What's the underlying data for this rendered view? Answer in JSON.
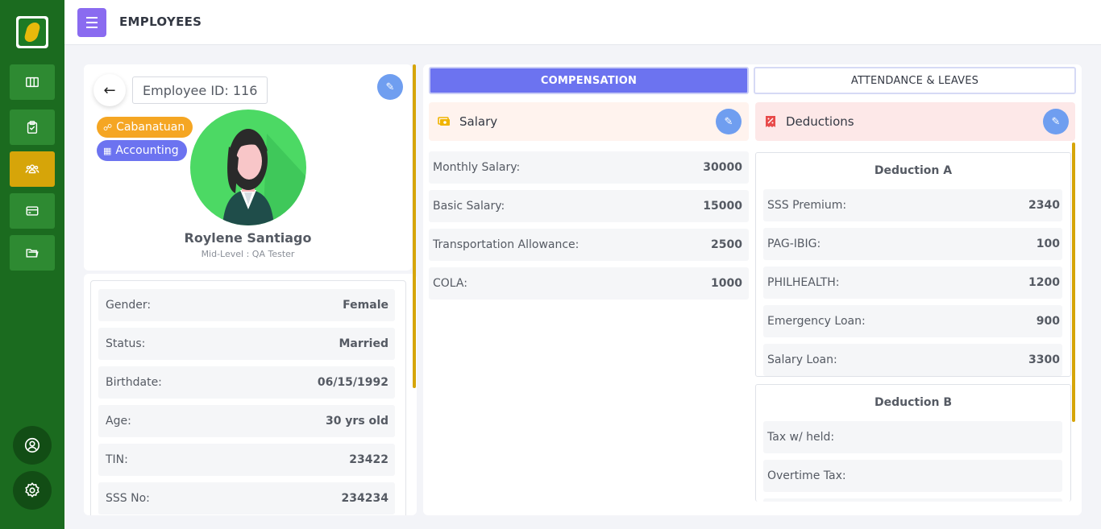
{
  "header": {
    "title": "EMPLOYEES"
  },
  "sidebar": {
    "items": [
      {
        "icon": "dashboard-icon",
        "active": false
      },
      {
        "icon": "clipboard-icon",
        "active": false
      },
      {
        "icon": "employees-icon",
        "active": true
      },
      {
        "icon": "payroll-card-icon",
        "active": false
      },
      {
        "icon": "folder-icon",
        "active": false
      }
    ],
    "bottom": [
      "profile-icon",
      "settings-icon"
    ]
  },
  "profile": {
    "employee_id": "Employee ID: 116",
    "branch": "Cabanatuan",
    "department": "Accounting",
    "name": "Roylene Santiago",
    "role": "Mid-Level : QA Tester"
  },
  "details": [
    {
      "label": "Gender:",
      "value": "Female"
    },
    {
      "label": "Status:",
      "value": "Married"
    },
    {
      "label": "Birthdate:",
      "value": "06/15/1992"
    },
    {
      "label": "Age:",
      "value": "30 yrs old"
    },
    {
      "label": "TIN:",
      "value": "23422"
    },
    {
      "label": "SSS No:",
      "value": "234234"
    }
  ],
  "tabs": {
    "compensation": "COMPENSATION",
    "attendance": "ATTENDANCE & LEAVES"
  },
  "salary": {
    "title": "Salary",
    "rows": [
      {
        "label": "Monthly Salary:",
        "value": "30000"
      },
      {
        "label": "Basic Salary:",
        "value": "15000"
      },
      {
        "label": "Transportation Allowance:",
        "value": "2500"
      },
      {
        "label": "COLA:",
        "value": "1000"
      }
    ]
  },
  "deductions": {
    "title": "Deductions",
    "group_a": {
      "title": "Deduction A",
      "rows": [
        {
          "label": "SSS Premium:",
          "value": "2340"
        },
        {
          "label": "PAG-IBIG:",
          "value": "100"
        },
        {
          "label": "PHILHEALTH:",
          "value": "1200"
        },
        {
          "label": "Emergency Loan:",
          "value": "900"
        },
        {
          "label": "Salary Loan:",
          "value": "3300"
        }
      ]
    },
    "group_b": {
      "title": "Deduction B",
      "rows": [
        {
          "label": "Tax w/ held:",
          "value": ""
        },
        {
          "label": "Overtime Tax:",
          "value": ""
        }
      ]
    }
  },
  "colors": {
    "sidebar": "#1b6b1f",
    "active": "#d6a509",
    "primary": "#6c73f0",
    "edit": "#6f9ef0"
  }
}
